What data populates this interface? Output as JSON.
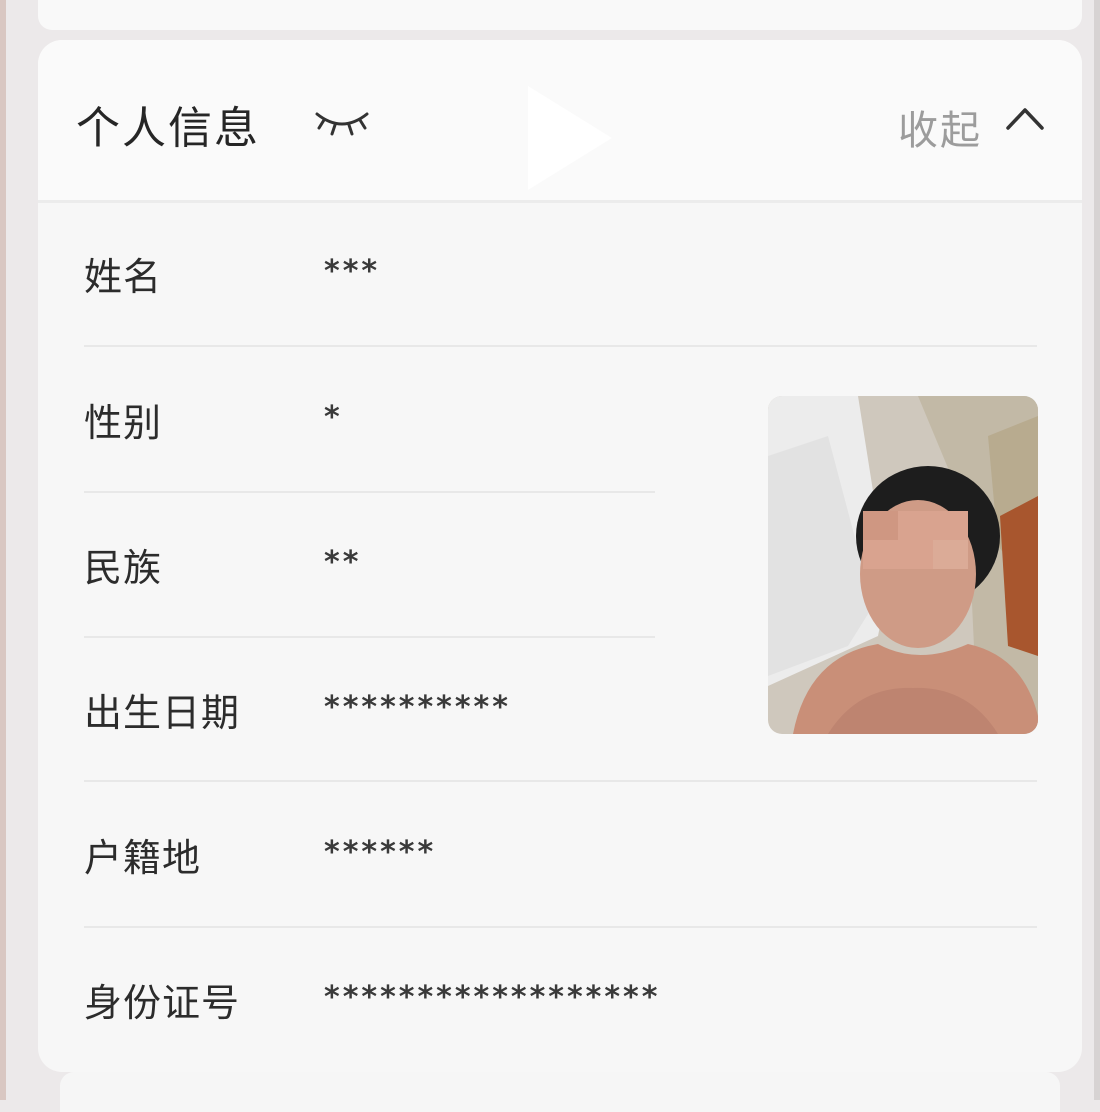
{
  "header": {
    "title": "个人信息",
    "collapse_label": "收起"
  },
  "rows": [
    {
      "label": "姓名",
      "value": "***"
    },
    {
      "label": "性别",
      "value": "*"
    },
    {
      "label": "民族",
      "value": "**"
    },
    {
      "label": "出生日期",
      "value": "**********"
    },
    {
      "label": "户籍地",
      "value": "******"
    },
    {
      "label": "身份证号",
      "value": "******************"
    }
  ],
  "icons": {
    "visibility": "eye-closed-icon",
    "play": "play-icon",
    "collapse": "chevron-up-icon"
  },
  "colors": {
    "card_background": "#f7f7f7",
    "text_primary": "#262626",
    "text_secondary": "#9c9c9c"
  }
}
